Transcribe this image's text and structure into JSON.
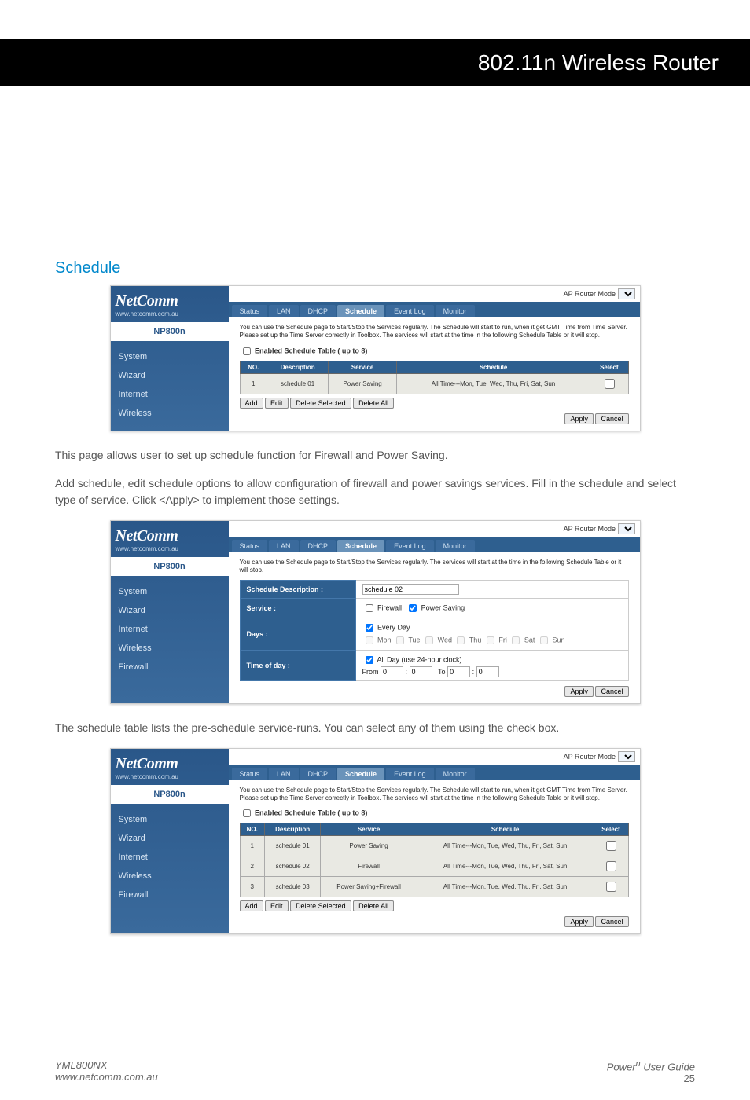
{
  "header": {
    "title": "802.11n Wireless Router"
  },
  "section": {
    "title": "Schedule"
  },
  "paragraphs": {
    "p1": "This page allows user to set up schedule function for Firewall and Power Saving.",
    "p2": "Add schedule, edit schedule options to allow configuration of firewall and power savings services. Fill in the schedule and select type of service. Click <Apply> to implement those settings.",
    "p3": "The schedule table lists the pre-schedule service-runs. You can select any of them using the check box."
  },
  "router": {
    "logo": "NetComm",
    "url": "www.netcomm.com.au",
    "model": "NP800n",
    "mode_label": "AP Router Mode",
    "nav": {
      "system": "System",
      "wizard": "Wizard",
      "internet": "Internet",
      "wireless": "Wireless",
      "firewall": "Firewall"
    },
    "tabs": {
      "status": "Status",
      "lan": "LAN",
      "dhcp": "DHCP",
      "schedule": "Schedule",
      "eventlog": "Event Log",
      "monitor": "Monitor"
    },
    "intro_full": "You can use the Schedule page to Start/Stop the Services regularly. The Schedule will start to run, when it get GMT Time from Time Server. Please set up the Time Server correctly in Toolbox. The services will start at the time in the following Schedule Table or it will stop.",
    "intro_short": "You can use the Schedule page to Start/Stop the Services regularly. The services will start at the time in the following Schedule Table or it will stop.",
    "enable_label": "Enabled Schedule Table ( up to 8)",
    "columns": {
      "no": "NO.",
      "desc": "Description",
      "service": "Service",
      "schedule": "Schedule",
      "select": "Select"
    },
    "schedule_all": "All Time---Mon, Tue, Wed, Thu, Fri, Sat, Sun",
    "rows1": [
      {
        "no": "1",
        "desc": "schedule 01",
        "service": "Power Saving"
      }
    ],
    "rows3": [
      {
        "no": "1",
        "desc": "schedule 01",
        "service": "Power Saving"
      },
      {
        "no": "2",
        "desc": "schedule 02",
        "service": "Firewall"
      },
      {
        "no": "3",
        "desc": "schedule 03",
        "service": "Power Saving+Firewall"
      }
    ],
    "buttons": {
      "add": "Add",
      "edit": "Edit",
      "delete_selected": "Delete Selected",
      "delete_all": "Delete All",
      "apply": "Apply",
      "cancel": "Cancel"
    },
    "form": {
      "desc_label": "Schedule Description :",
      "desc_value": "schedule 02",
      "service_label": "Service :",
      "service_firewall": "Firewall",
      "service_power": "Power Saving",
      "days_label": "Days :",
      "every_day": "Every Day",
      "mon": "Mon",
      "tue": "Tue",
      "wed": "Wed",
      "thu": "Thu",
      "fri": "Fri",
      "sat": "Sat",
      "sun": "Sun",
      "time_label": "Time of day :",
      "all_day": "All Day (use 24-hour clock)",
      "from": "From",
      "to": "To",
      "from_h": "0",
      "from_m": "0",
      "to_h": "0",
      "to_m": "0"
    }
  },
  "footer": {
    "model": "YML800NX",
    "url": "www.netcomm.com.au",
    "guide": "Power",
    "guide_sup": "n",
    "guide_tail": " User Guide",
    "page": "25"
  }
}
